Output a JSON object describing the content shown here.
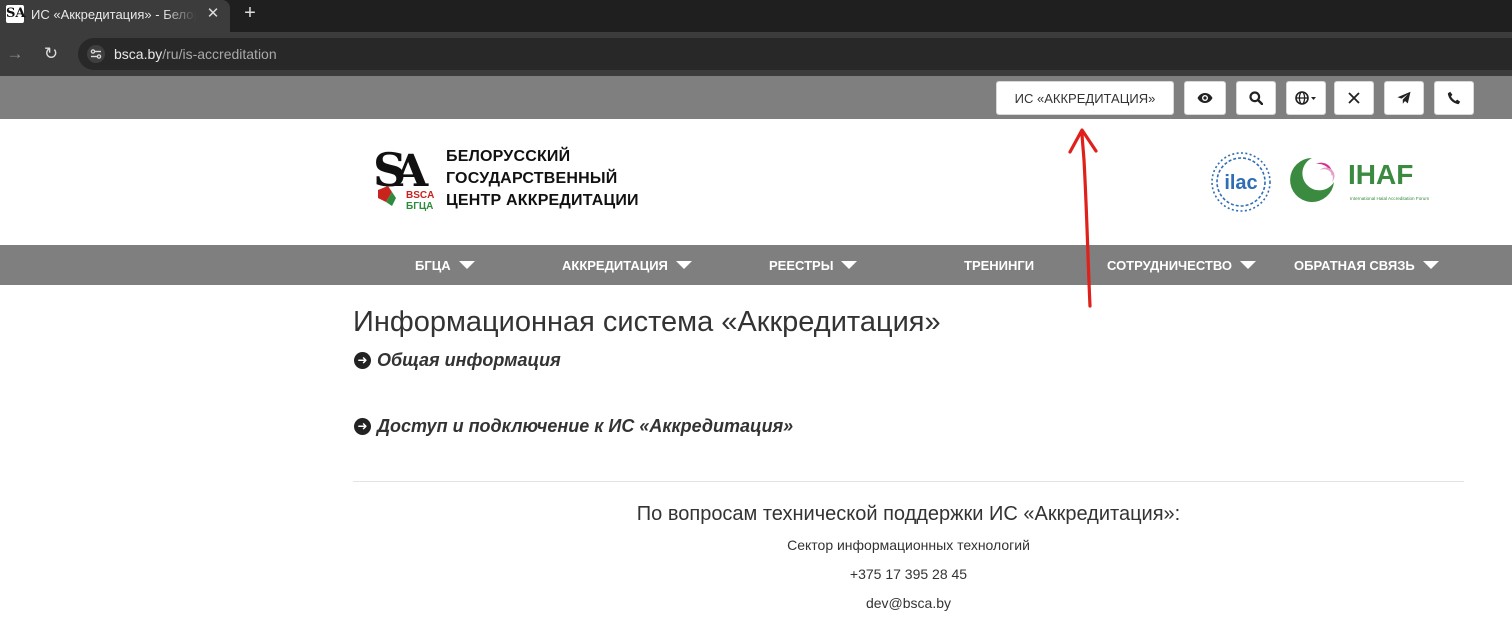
{
  "browser": {
    "tab_title": "ИС «Аккредитация» - Белорусский",
    "tab_favicon_text": "SA",
    "url_host": "bsca.by",
    "url_path": "/ru/is-accreditation"
  },
  "topbar": {
    "is_button_label": "ИС «АККРЕДИТАЦИЯ»",
    "icons": [
      "eye-icon",
      "search-icon",
      "globe-icon",
      "x-icon",
      "telegram-icon",
      "phone-icon"
    ]
  },
  "header": {
    "org_name_line1": "БЕЛОРУССКИЙ",
    "org_name_line2": "ГОСУДАРСТВЕННЫЙ",
    "org_name_line3": "ЦЕНТР АККРЕДИТАЦИИ",
    "logo_text_latin": "BSCA",
    "logo_text_cyr": "БГЦА",
    "partner_logo_1": "ilac",
    "partner_logo_2": "IHAF",
    "partner_logo_2_tagline": "International Halal Accreditation Forum"
  },
  "nav": {
    "items": [
      {
        "label": "БГЦА"
      },
      {
        "label": "АККРЕДИТАЦИЯ"
      },
      {
        "label": "РЕЕСТРЫ"
      },
      {
        "label": "ТРЕНИНГИ"
      },
      {
        "label": "СОТРУДНИЧЕСТВО"
      },
      {
        "label": "ОБРАТНАЯ СВЯЗЬ"
      }
    ]
  },
  "main": {
    "title": "Информационная система «Аккредитация»",
    "sections": [
      {
        "label": "Общая информация"
      },
      {
        "label": "Доступ и подключение к ИС «Аккредитация»"
      }
    ],
    "support": {
      "title": "По вопросам технической поддержки ИС «Аккредитация»:",
      "department": "Сектор информационных технологий",
      "phone": "+375 17 395 28 45",
      "email": "dev@bsca.by"
    }
  },
  "colors": {
    "bar_gray": "#7f7f7f",
    "annotation_red": "#e0201b",
    "ihaf_green": "#3a8a3f"
  }
}
